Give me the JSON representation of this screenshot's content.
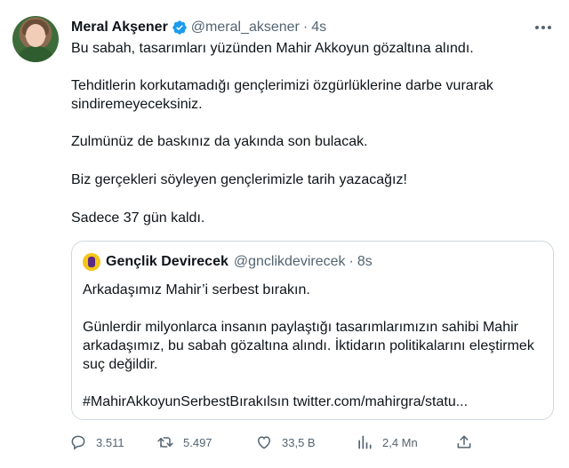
{
  "tweet": {
    "author_name": "Meral Akşener",
    "handle": "@meral_aksener",
    "separator": "·",
    "time": "4s",
    "paragraphs": [
      "Bu sabah, tasarımları yüzünden Mahir Akkoyun gözaltına alındı.",
      "Tehditlerin korkutamadığı gençlerimizi özgürlüklerine darbe vurarak sindiremeyeceksiniz.",
      "Zulmünüz de baskınız da yakında son bulacak.",
      "Biz gerçekleri söyleyen gençlerimizle tarih yazacağız!",
      "Sadece 37 gün kaldı."
    ]
  },
  "quote": {
    "author_name": "Gençlik Devirecek",
    "handle": "@gnclikdevirecek",
    "separator": "·",
    "time": "8s",
    "paragraphs": [
      "Arkadaşımız Mahir’i serbest bırakın.",
      "Günlerdir milyonlarca insanın paylaştığı tasarımlarımızın sahibi Mahir arkadaşımız, bu sabah gözaltına alındı. İktidarın politikalarını eleştirmek suç değildir.",
      "#MahirAkkoyunSerbestBırakılsın twitter.com/mahirgra/statu..."
    ]
  },
  "actions": {
    "replies": "3.511",
    "retweets": "5.497",
    "likes": "33,5 B",
    "views": "2,4 Mn"
  },
  "icons": {
    "verified": "verified-badge-icon",
    "more": "more-options-icon",
    "reply": "reply-icon",
    "retweet": "retweet-icon",
    "like": "heart-icon",
    "views": "views-icon",
    "share": "share-icon"
  },
  "colors": {
    "text": "#0f1419",
    "secondary": "#536471",
    "verified": "#1d9bf0",
    "border": "#cfd9de"
  }
}
